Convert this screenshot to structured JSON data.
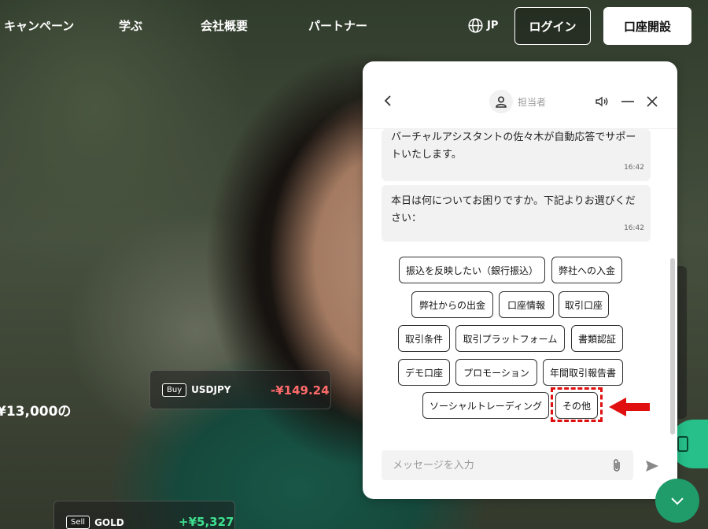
{
  "nav": {
    "items": [
      "キャンペーン",
      "学ぶ",
      "会社概要",
      "パートナー"
    ],
    "lang": "JP",
    "login": "ログイン",
    "open_account": "口座開設"
  },
  "tickers": [
    {
      "badge": "Buy",
      "symbol": "USDJPY",
      "price": "-¥149.24"
    },
    {
      "badge": "Sell",
      "symbol": "GOLD",
      "price": "+¥5,327"
    }
  ],
  "promo_text": "¥13,000の",
  "chat": {
    "agent_label": "担当者",
    "messages": [
      {
        "text": "バーチャルアシスタントの佐々木が自動応答でサポートいたします。",
        "time": "16:42"
      },
      {
        "text": "本日は何についてお困りですか。下記よりお選びください：",
        "time": "16:42"
      }
    ],
    "options": [
      "振込を反映したい（銀行振込）",
      "弊社への入金",
      "弊社からの出金",
      "口座情報",
      "取引口座",
      "取引条件",
      "取引プラットフォーム",
      "書類認証",
      "デモ口座",
      "プロモーション",
      "年間取引報告書",
      "ソーシャルトレーディング",
      "その他"
    ],
    "input_placeholder": "メッセージを入力"
  },
  "colors": {
    "accent_green": "#1f9c6a",
    "highlight_red": "#e01010",
    "sell_price": "#3ee08f",
    "buy_price": "#ff6b6b"
  }
}
